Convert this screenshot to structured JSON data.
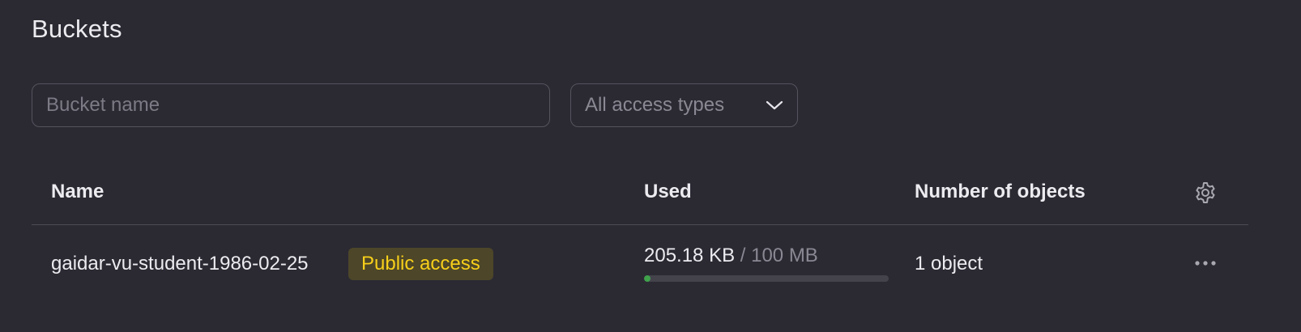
{
  "page": {
    "title": "Buckets"
  },
  "filters": {
    "search_placeholder": "Bucket name",
    "search_value": "",
    "access_select_value": "All access types"
  },
  "table": {
    "columns": [
      "Name",
      "Used",
      "Number of objects"
    ],
    "settings_icon": "gear-icon",
    "rows": [
      {
        "name": "gaidar-vu-student-1986-02-25",
        "badge": "Public access",
        "used": "205.18 KB",
        "used_total": "/ 100 MB",
        "usage_fraction": 0.002,
        "objects": "1 object",
        "actions_icon": "more-horizontal-icon"
      }
    ]
  },
  "colors": {
    "background": "#2b2a33",
    "badge_bg": "#4d4628",
    "badge_text": "#f7cf1a",
    "usage_fill": "#3fa24b"
  }
}
